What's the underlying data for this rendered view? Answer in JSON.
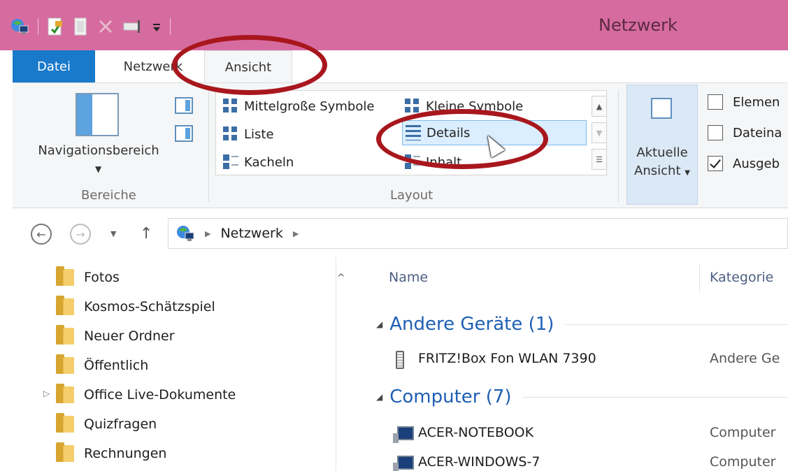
{
  "window": {
    "title": "Netzwerk",
    "titlebar_color": "#d66ba0",
    "qat_icons": [
      "network-icon",
      "properties-icon",
      "new-folder-icon",
      "delete-icon",
      "rename-icon",
      "customize-qat-icon"
    ]
  },
  "tabs": {
    "file": "Datei",
    "network": "Netzwerk",
    "view": "Ansicht",
    "file_color": "#1979ca"
  },
  "ribbon": {
    "panes_group": {
      "label": "Bereiche",
      "nav_pane_button": "Navigationsbereich"
    },
    "layout_group": {
      "label": "Layout",
      "options": [
        "Mittelgroße Symbole",
        "Kleine Symbole",
        "Liste",
        "Details",
        "Kacheln",
        "Inhalt"
      ],
      "selected": "Details"
    },
    "current_view": {
      "line1": "Aktuelle",
      "line2": "Ansicht"
    },
    "show_hide": {
      "items": [
        {
          "label": "Elemen",
          "checked": false
        },
        {
          "label": "Dateina",
          "checked": false
        },
        {
          "label": "Ausgeb",
          "checked": true
        }
      ]
    }
  },
  "address_bar": {
    "breadcrumb": "Netzwerk"
  },
  "nav_pane": {
    "items": [
      "Fotos",
      "Kosmos-Schätzspiel",
      "Neuer Ordner",
      "Öffentlich",
      "Office Live-Dokumente",
      "Quizfragen",
      "Rechnungen"
    ]
  },
  "content": {
    "columns": {
      "name": "Name",
      "category": "Kategorie"
    },
    "groups": [
      {
        "title": "Andere Geräte (1)",
        "items": [
          {
            "name": "FRITZ!Box Fon WLAN 7390",
            "category": "Andere Ge",
            "icon": "router-icon"
          }
        ]
      },
      {
        "title": "Computer (7)",
        "items": [
          {
            "name": "ACER-NOTEBOOK",
            "category": "Computer",
            "icon": "computer-icon"
          },
          {
            "name": "ACER-WINDOWS-7",
            "category": "Computer",
            "icon": "computer-icon"
          }
        ]
      }
    ]
  },
  "annotation_color": "#a8171d"
}
